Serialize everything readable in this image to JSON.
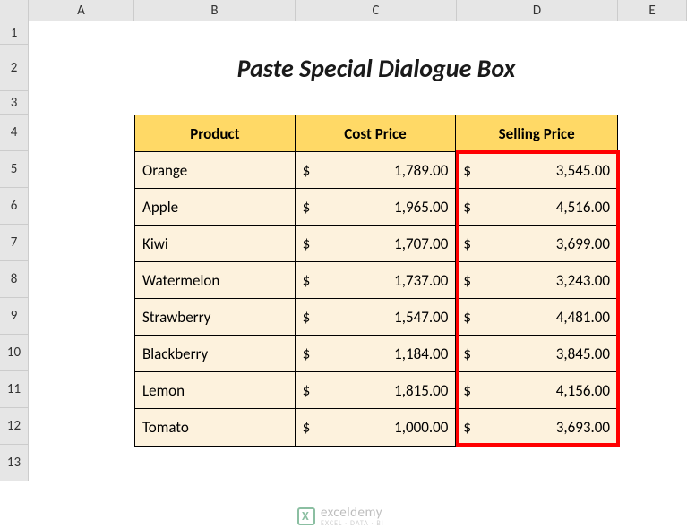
{
  "columns": [
    "A",
    "B",
    "C",
    "D",
    "E"
  ],
  "row_numbers": [
    "1",
    "2",
    "3",
    "4",
    "5",
    "6",
    "7",
    "8",
    "9",
    "10",
    "11",
    "12",
    "13"
  ],
  "title": "Paste Special Dialogue Box",
  "headers": {
    "product": "Product",
    "cost": "Cost Price",
    "selling": "Selling Price"
  },
  "currency": "$",
  "data": [
    {
      "product": "Orange",
      "cost": "1,789.00",
      "selling": "3,545.00"
    },
    {
      "product": "Apple",
      "cost": "1,965.00",
      "selling": "4,516.00"
    },
    {
      "product": "Kiwi",
      "cost": "1,707.00",
      "selling": "3,699.00"
    },
    {
      "product": "Watermelon",
      "cost": "1,737.00",
      "selling": "3,243.00"
    },
    {
      "product": "Strawberry",
      "cost": "1,547.00",
      "selling": "4,481.00"
    },
    {
      "product": "Blackberry",
      "cost": "1,184.00",
      "selling": "3,845.00"
    },
    {
      "product": "Lemon",
      "cost": "1,815.00",
      "selling": "4,156.00"
    },
    {
      "product": "Tomato",
      "cost": "1,000.00",
      "selling": "3,693.00"
    }
  ],
  "watermark": {
    "name": "exceldemy",
    "tagline": "EXCEL · DATA · BI"
  },
  "chart_data": {
    "type": "table",
    "title": "Paste Special Dialogue Box",
    "columns": [
      "Product",
      "Cost Price",
      "Selling Price"
    ],
    "rows": [
      [
        "Orange",
        1789.0,
        3545.0
      ],
      [
        "Apple",
        1965.0,
        4516.0
      ],
      [
        "Kiwi",
        1707.0,
        3699.0
      ],
      [
        "Watermelon",
        1737.0,
        3243.0
      ],
      [
        "Strawberry",
        1547.0,
        4481.0
      ],
      [
        "Blackberry",
        1184.0,
        3845.0
      ],
      [
        "Lemon",
        1815.0,
        4156.0
      ],
      [
        "Tomato",
        1000.0,
        3693.0
      ]
    ],
    "currency": "USD",
    "highlighted_column": "Selling Price"
  }
}
